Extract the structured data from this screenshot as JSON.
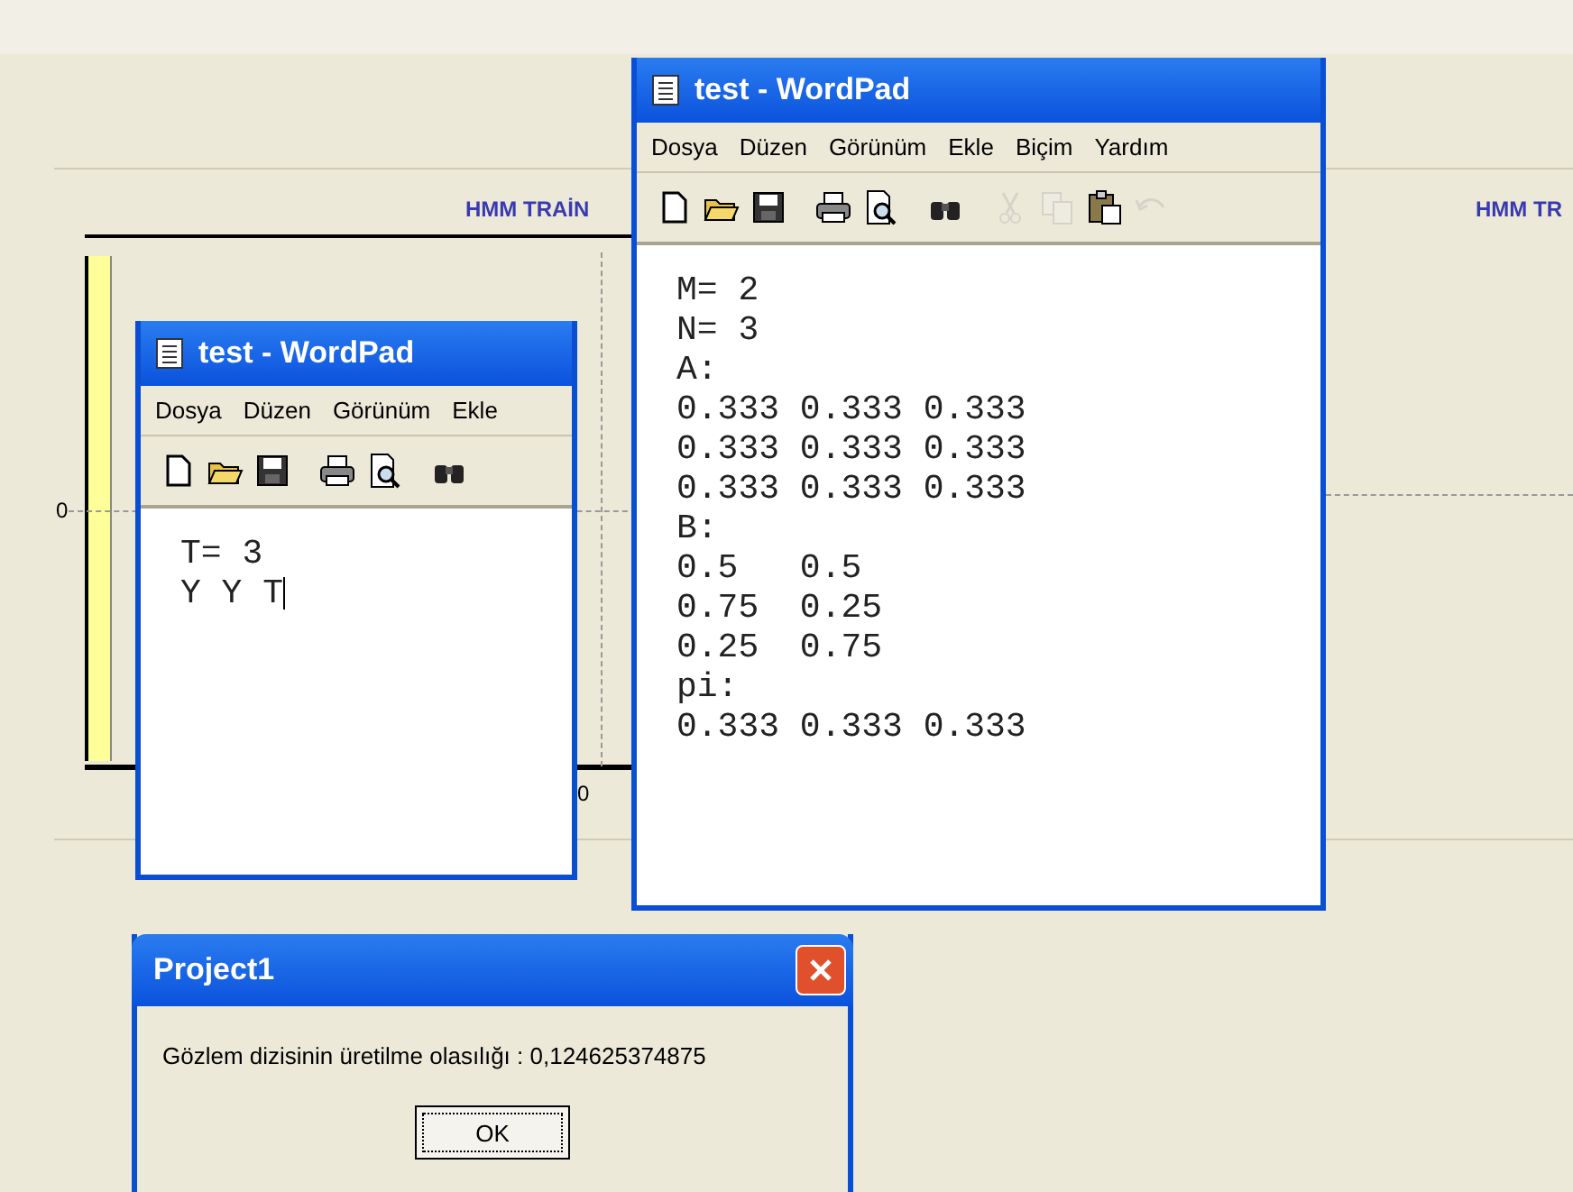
{
  "background": {
    "chart_title": "HMM TRAİN",
    "chart_title_2": "HMM TR",
    "y_axis_label": "0",
    "x_axis_label": "0"
  },
  "windows": [
    {
      "title": "test - WordPad",
      "menu": [
        "Dosya",
        "Düzen",
        "Görünüm",
        "Ekle"
      ],
      "toolbar": [
        {
          "kind": "new",
          "disabled": false
        },
        {
          "kind": "open",
          "disabled": false
        },
        {
          "kind": "save",
          "disabled": false
        },
        {
          "kind": "print",
          "disabled": false
        },
        {
          "kind": "preview",
          "disabled": false
        },
        {
          "kind": "find",
          "disabled": false
        }
      ],
      "lines": [
        "T= 3",
        "Y Y T"
      ],
      "caret": true
    },
    {
      "title": "test - WordPad",
      "menu": [
        "Dosya",
        "Düzen",
        "Görünüm",
        "Ekle",
        "Biçim",
        "Yardım"
      ],
      "toolbar": [
        {
          "kind": "new",
          "disabled": false
        },
        {
          "kind": "open",
          "disabled": false
        },
        {
          "kind": "save",
          "disabled": false
        },
        {
          "kind": "print",
          "disabled": false
        },
        {
          "kind": "preview",
          "disabled": false
        },
        {
          "kind": "find",
          "disabled": false
        },
        {
          "kind": "cut",
          "disabled": true
        },
        {
          "kind": "copy",
          "disabled": true
        },
        {
          "kind": "paste",
          "disabled": false
        },
        {
          "kind": "undo",
          "disabled": true
        }
      ],
      "lines": [
        "M= 2",
        "N= 3",
        "A:",
        "0.333 0.333 0.333",
        "0.333 0.333 0.333",
        "0.333 0.333 0.333",
        "B:",
        "0.5   0.5",
        "0.75  0.25",
        "0.25  0.75",
        "pi:",
        "0.333 0.333 0.333"
      ],
      "caret": false
    }
  ],
  "dialog": {
    "title": "Project1",
    "message": "Gözlem dizisinin üretilme olasılığı : 0,124625374875",
    "button": "OK"
  }
}
